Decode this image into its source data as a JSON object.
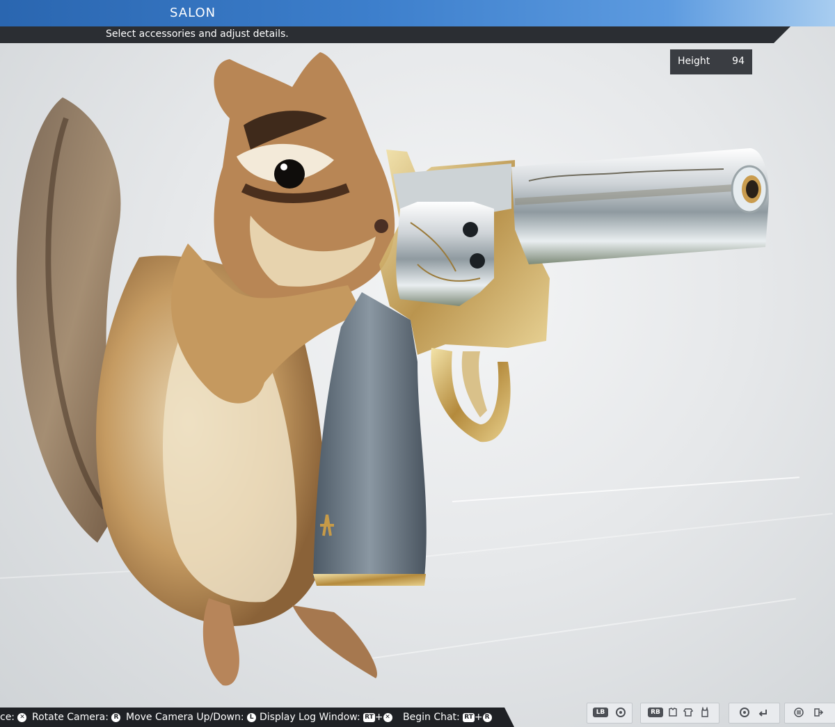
{
  "header": {
    "title": "SALON",
    "subtitle": "Select accessories and adjust details."
  },
  "readout": {
    "label": "Height",
    "value": "94"
  },
  "controls": [
    {
      "label": "ce:",
      "key": "✕"
    },
    {
      "label": "Rotate Camera:",
      "key": "R"
    },
    {
      "label": "Move Camera Up/Down:",
      "key": "L"
    },
    {
      "label": "Display Log Window:",
      "key1": "RT",
      "key2": "✕"
    },
    {
      "label": "Begin Chat:",
      "key1": "RT",
      "key2": "R"
    }
  ],
  "menu": {
    "lb": "LB",
    "rb": "RB"
  },
  "colors": {
    "header_blue": "#2a66b0",
    "bar_dark": "#1f2125",
    "panel": "#3a3d42"
  }
}
